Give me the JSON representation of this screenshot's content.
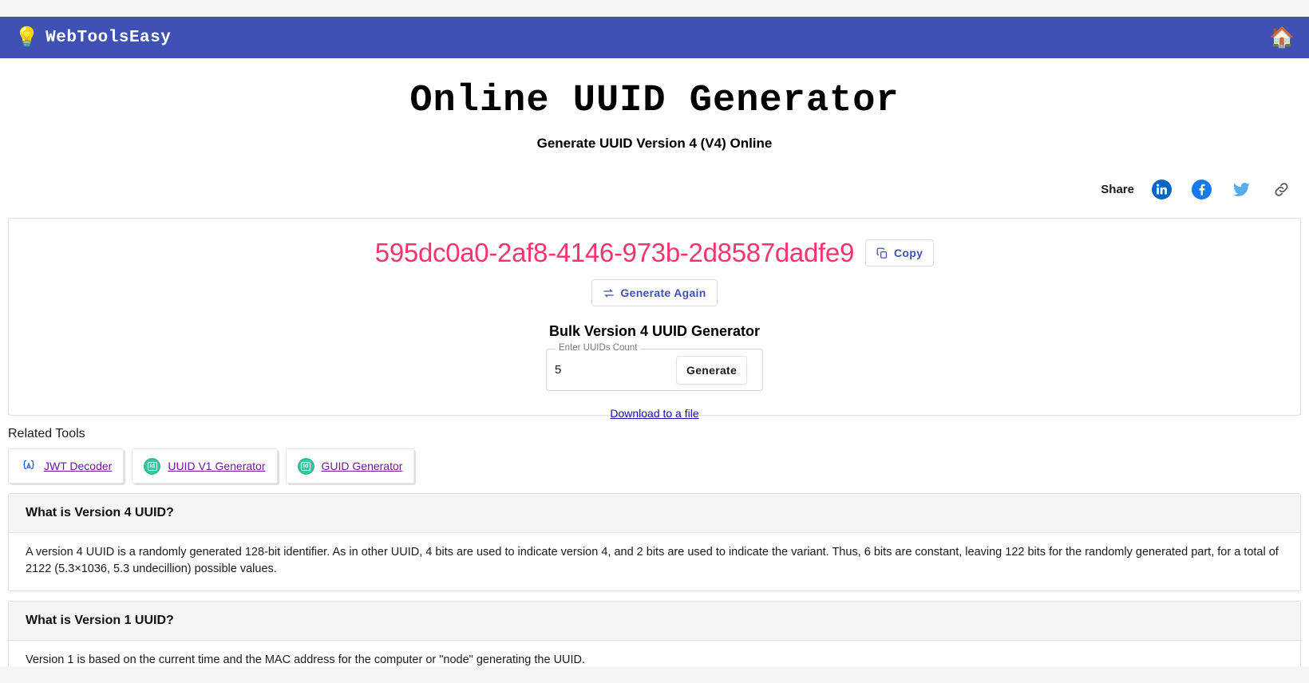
{
  "navbar": {
    "brand_name": "WebToolsEasy",
    "bulb_icon": "bulb-icon",
    "home_icon": "home-icon",
    "brand_bg": "#3f51b5"
  },
  "header": {
    "title": "Online UUID Generator",
    "subtitle": "Generate UUID Version 4 (V4) Online"
  },
  "share": {
    "label": "Share",
    "items": [
      {
        "name": "linkedin-share-icon",
        "color": "#0a66c2"
      },
      {
        "name": "facebook-share-icon",
        "color": "#1877f2"
      },
      {
        "name": "twitter-share-icon",
        "color": "#55acee"
      },
      {
        "name": "copy-link-share-icon",
        "color": "#555555"
      }
    ]
  },
  "generator": {
    "uuid_value": "595dc0a0-2af8-4146-973b-2d8587dadfe9",
    "uuid_color": "#f5356e",
    "copy_label": "Copy",
    "generate_again_label": "Generate Again",
    "bulk_title": "Bulk Version 4 UUID Generator",
    "bulk_legend": "Enter UUIDs Count",
    "bulk_count_value": "5",
    "bulk_count_placeholder": "Enter UUIDs Count",
    "bulk_generate_label": "Generate",
    "download_link_label": "Download to a file"
  },
  "related_tools": {
    "title": "Related Tools",
    "items": [
      {
        "label": "JWT Decoder",
        "icon": "jwt-icon"
      },
      {
        "label": "UUID V1 Generator",
        "icon": "id-badge-icon"
      },
      {
        "label": "GUID Generator",
        "icon": "id-badge-icon"
      }
    ]
  },
  "faqs": [
    {
      "question": "What is Version 4 UUID?",
      "answer": "A version 4 UUID is a randomly generated 128-bit identifier. As in other UUID, 4 bits are used to indicate version 4, and 2 bits are used to indicate the variant. Thus, 6 bits are constant, leaving 122 bits for the randomly generated part, for a total of 2122 (5.3×1036, 5.3 undecillion) possible values."
    },
    {
      "question": "What is Version 1 UUID?",
      "answer": "Version 1 is based on the current time and the MAC address for the computer or \"node\" generating the UUID."
    }
  ]
}
